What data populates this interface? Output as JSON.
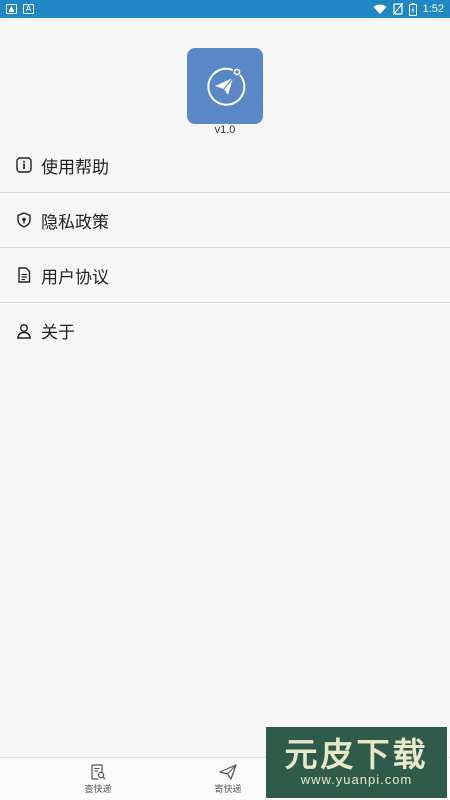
{
  "status_bar": {
    "left_icons": [
      "image-icon",
      "a-icon"
    ],
    "right_icons": [
      "wifi-icon",
      "no-sim-icon",
      "battery-icon"
    ],
    "time": "1:52"
  },
  "app": {
    "icon": "paper-plane-icon",
    "version": "v1.0",
    "accent": "#5a87c6"
  },
  "menu": {
    "items": [
      {
        "label": "使用帮助",
        "icon": "info-icon"
      },
      {
        "label": "隐私政策",
        "icon": "shield-icon"
      },
      {
        "label": "用户协议",
        "icon": "document-icon"
      },
      {
        "label": "关于",
        "icon": "person-icon"
      }
    ]
  },
  "bottom_nav": {
    "items": [
      {
        "label": "查快递",
        "icon": "search-document-icon"
      },
      {
        "label": "寄快递",
        "icon": "send-icon"
      }
    ]
  },
  "watermark": {
    "title": "元皮下载",
    "url": "www.yuanpi.com"
  }
}
